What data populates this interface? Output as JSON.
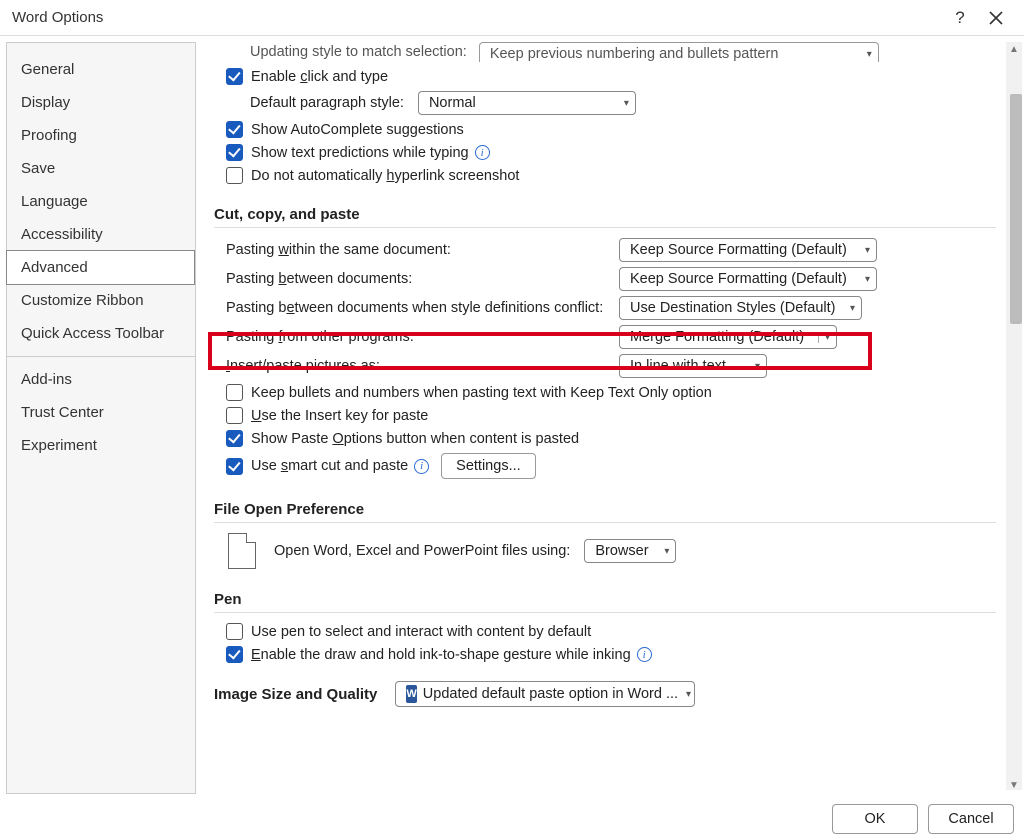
{
  "window": {
    "title": "Word Options"
  },
  "sidebar": {
    "items": [
      "General",
      "Display",
      "Proofing",
      "Save",
      "Language",
      "Accessibility",
      "Advanced",
      "Customize Ribbon",
      "Quick Access Toolbar"
    ],
    "items2": [
      "Add-ins",
      "Trust Center",
      "Experiment"
    ],
    "selected": "Advanced"
  },
  "top": {
    "updating_label": "Updating style to match selection:",
    "updating_value": "Keep previous numbering and bullets pattern",
    "enable_click_type": "Enable click and type",
    "default_para_label": "Default paragraph style:",
    "default_para_value": "Normal",
    "autocomplete": "Show AutoComplete suggestions",
    "predictions": "Show text predictions while typing",
    "no_hyperlink": "Do not automatically hyperlink screenshot"
  },
  "sections": {
    "cut_copy_paste": "Cut, copy, and paste",
    "file_open": "File Open Preference",
    "pen": "Pen",
    "image_quality": "Image Size and Quality"
  },
  "paste": {
    "within_label": "Pasting within the same document:",
    "within_value": "Keep Source Formatting (Default)",
    "between_label": "Pasting between documents:",
    "between_value": "Keep Source Formatting (Default)",
    "conflict_label": "Pasting between documents when style definitions conflict:",
    "conflict_value": "Use Destination Styles (Default)",
    "other_label": "Pasting from other programs:",
    "other_value": "Merge Formatting (Default)",
    "pictures_label": "Insert/paste pictures as:",
    "pictures_value": "In line with text",
    "keep_bullets": "Keep bullets and numbers when pasting text with Keep Text Only option",
    "insert_key": "Use the Insert key for paste",
    "show_paste_options": "Show Paste Options button when content is pasted",
    "smart_cut": "Use smart cut and paste",
    "settings_btn": "Settings..."
  },
  "fileopen": {
    "label": "Open Word, Excel and PowerPoint files using:",
    "value": "Browser"
  },
  "pen": {
    "use_pen": "Use pen to select and interact with content by default",
    "draw_hold": "Enable the draw and hold ink-to-shape gesture while inking"
  },
  "image_quality": {
    "value": "Updated default paste option in Word ..."
  },
  "footer": {
    "ok": "OK",
    "cancel": "Cancel"
  }
}
